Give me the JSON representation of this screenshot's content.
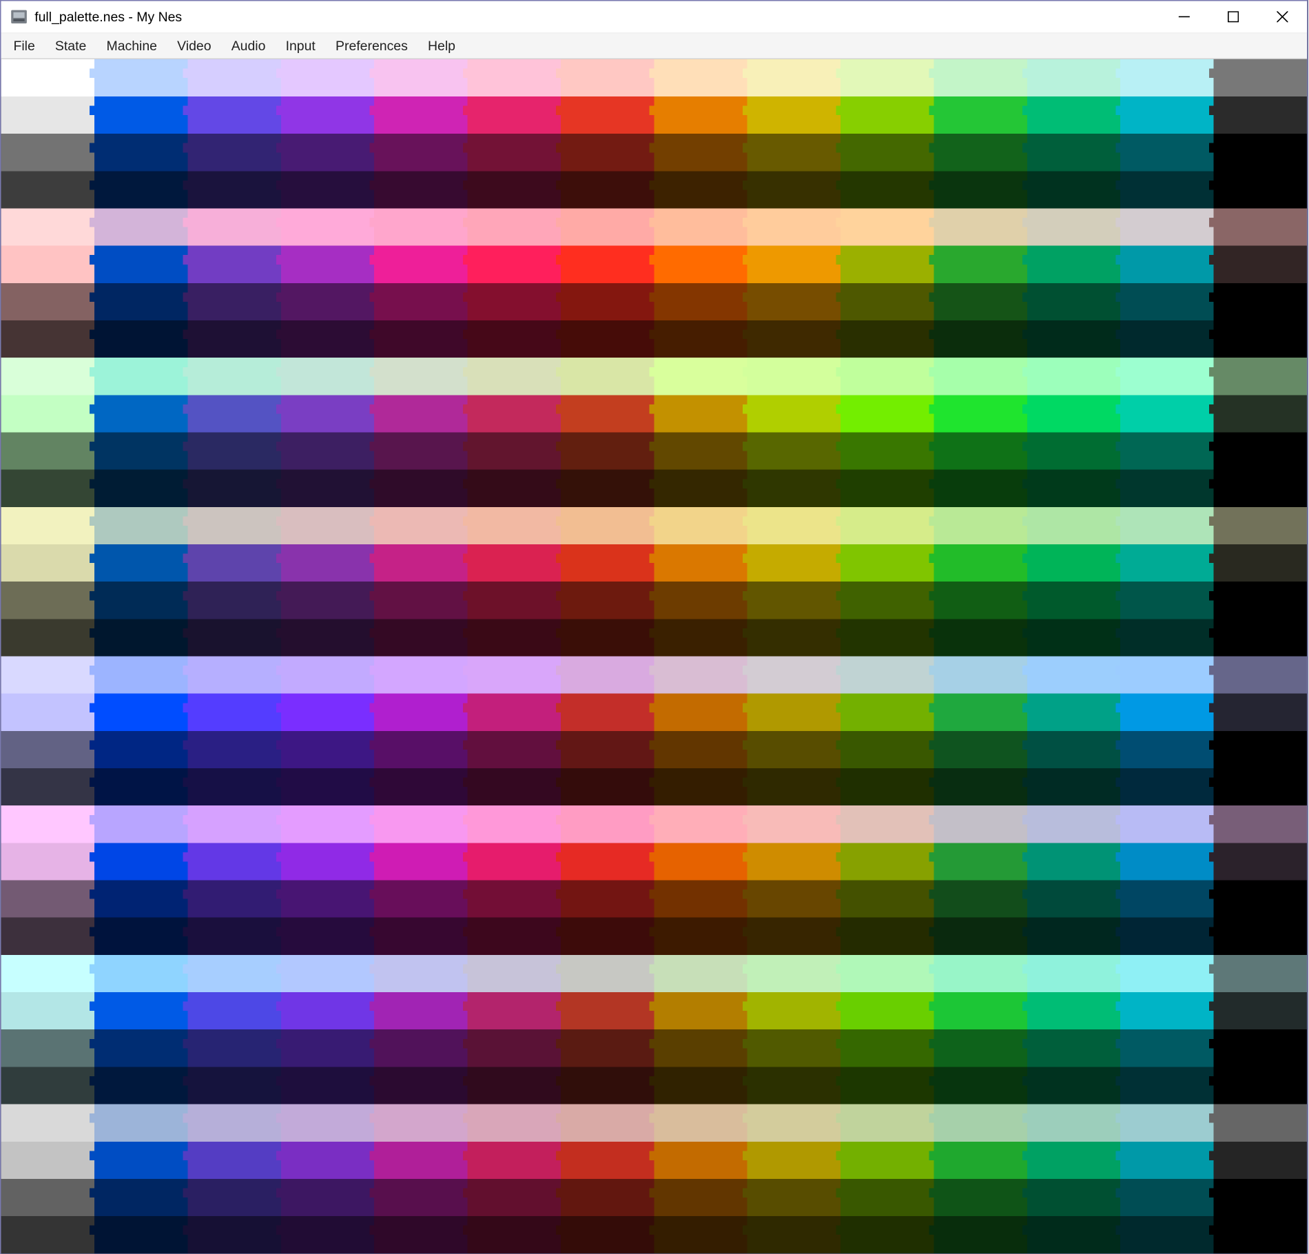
{
  "window": {
    "title": "full_palette.nes - My Nes",
    "icon_name": "nes-cartridge-icon"
  },
  "window_controls": {
    "minimize_label": "Minimize",
    "maximize_label": "Maximize",
    "close_label": "Close"
  },
  "menubar": {
    "items": [
      {
        "label": "File"
      },
      {
        "label": "State"
      },
      {
        "label": "Machine"
      },
      {
        "label": "Video"
      },
      {
        "label": "Audio"
      },
      {
        "label": "Input"
      },
      {
        "label": "Preferences"
      },
      {
        "label": "Help"
      }
    ]
  },
  "emulator": {
    "screen_name": "nes-full-palette-display",
    "cols": 14,
    "blocks": 8,
    "rows_per_block": 4,
    "hue_base": [
      {
        "r": 255,
        "g": 255,
        "b": 255,
        "gray": true
      },
      {
        "r": 0,
        "g": 100,
        "b": 255
      },
      {
        "r": 110,
        "g": 80,
        "b": 255
      },
      {
        "r": 160,
        "g": 60,
        "b": 255
      },
      {
        "r": 230,
        "g": 40,
        "b": 200
      },
      {
        "r": 255,
        "g": 40,
        "b": 120
      },
      {
        "r": 255,
        "g": 60,
        "b": 40
      },
      {
        "r": 255,
        "g": 140,
        "b": 0
      },
      {
        "r": 230,
        "g": 200,
        "b": 0
      },
      {
        "r": 150,
        "g": 230,
        "b": 0
      },
      {
        "r": 40,
        "g": 220,
        "b": 60
      },
      {
        "r": 0,
        "g": 210,
        "b": 130
      },
      {
        "r": 0,
        "g": 200,
        "b": 220
      },
      {
        "r": 120,
        "g": 120,
        "b": 120,
        "gray": true,
        "dark": true
      }
    ],
    "emphasis": [
      {
        "r": 1.0,
        "g": 1.0,
        "b": 1.0
      },
      {
        "r": 1.15,
        "g": 0.85,
        "b": 0.85
      },
      {
        "r": 0.85,
        "g": 1.15,
        "b": 0.85
      },
      {
        "r": 0.95,
        "g": 0.95,
        "b": 0.75
      },
      {
        "r": 0.85,
        "g": 0.85,
        "b": 1.15
      },
      {
        "r": 1.0,
        "g": 0.78,
        "b": 1.0
      },
      {
        "r": 0.78,
        "g": 1.0,
        "b": 1.0
      },
      {
        "r": 0.85,
        "g": 0.85,
        "b": 0.85
      }
    ],
    "brightness": [
      1.0,
      0.9,
      0.45,
      0.24
    ]
  }
}
